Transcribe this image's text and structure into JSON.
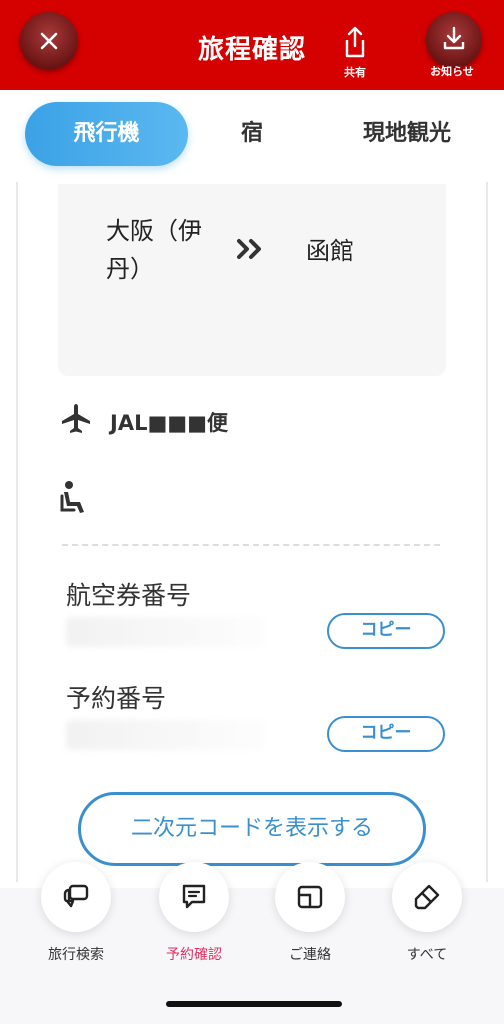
{
  "header": {
    "title": "旅程確認",
    "share_label": "共有",
    "notice_label": "お知らせ",
    "color": "#d50000"
  },
  "tabs": [
    {
      "label": "飛行機",
      "active": true
    },
    {
      "label": "宿",
      "active": false
    },
    {
      "label": "現地観光",
      "active": false
    }
  ],
  "flight": {
    "origin": "大阪（伊丹）",
    "destination": "函館",
    "flight_number": "JAL■■■便",
    "arrow_icon": "double-chevron-right-icon"
  },
  "ticket": {
    "label": "航空券番号",
    "copy_label": "コピー"
  },
  "booking": {
    "label": "予約番号",
    "copy_label": "コピー"
  },
  "qr_button": "二次元コードを表示する",
  "bottom_nav": [
    {
      "label": "旅行検索",
      "icon": "chat-bubbles-icon",
      "active": false
    },
    {
      "label": "予約確認",
      "icon": "message-icon",
      "active": true
    },
    {
      "label": "ご連絡",
      "icon": "window-icon",
      "active": false
    },
    {
      "label": "すべて",
      "icon": "eraser-icon",
      "active": false
    }
  ],
  "colors": {
    "accent_blue": "#3a90cf",
    "tab_active": "#3ba2e6",
    "nav_active": "#e0325f"
  }
}
